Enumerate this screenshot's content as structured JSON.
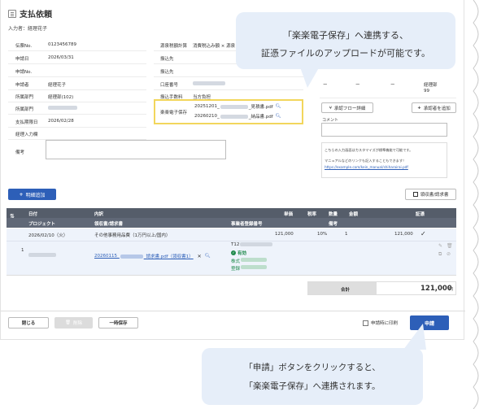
{
  "header": {
    "title": "支払依頼",
    "inputter": "入力者：経理花子"
  },
  "form_left": [
    {
      "label": "伝票No.",
      "value": "0123456789"
    },
    {
      "label": "申請日",
      "value": "2026/03/31"
    },
    {
      "label": "申請No.",
      "value": ""
    },
    {
      "label": "申請者",
      "value": "経理花子"
    },
    {
      "label": "所属部門",
      "value": "経理部(102)"
    },
    {
      "label": "所属部門",
      "value": ""
    },
    {
      "label": "支払期限日",
      "value": "2026/02/28"
    },
    {
      "label": "経理入力欄",
      "value": ""
    },
    {
      "label": "備考",
      "value": ""
    }
  ],
  "form_mid": [
    {
      "label": "源泉税額計算",
      "value": "消費税込み額 × 源泉"
    },
    {
      "label": "振込先",
      "value": ""
    },
    {
      "label": "振込先",
      "value": ""
    },
    {
      "label": "口座番号",
      "value": ""
    },
    {
      "label": "振込手数料",
      "value": "当方負担"
    }
  ],
  "rakuraku": {
    "label": "楽楽電子保存",
    "file1_prefix": "20251201_",
    "file1_suffix": "_見積書.pdf",
    "file2_prefix": "20260210_",
    "file2_suffix": "_納品書.pdf"
  },
  "approval": {
    "cols": [
      "ー",
      "ー",
      "ー",
      "経理部"
    ],
    "sub": "99",
    "flow_button": "承認フロー詳細",
    "add_approver_button": "承認者を追加",
    "comment_label": "コメント"
  },
  "notice": {
    "line1": "こちらの入力画面はカスタマイズが標準機能で可能です。",
    "line2": "マニュアルなどのリンクも記入することもできます！",
    "link": "https://example.com/kein_manual/shiharairai.pdf"
  },
  "toolbar": {
    "add_detail": "明細追加",
    "receipt_button": "領収書/請求書"
  },
  "table": {
    "head1": [
      "日付",
      "内訳",
      "単価",
      "税率",
      "数量",
      "金額",
      "証憑"
    ],
    "head2": [
      "プロジェクト",
      "領収書/請求書",
      "事業者登録番号",
      "備考"
    ],
    "row": {
      "no": "1",
      "date": "2026/02/10（火）",
      "item": "その他事務用品費（1万円以上/国内）",
      "unit_price": "121,000",
      "tax_rate": "10%",
      "quantity": "1",
      "amount": "121,000",
      "file_prefix": "20260115_",
      "file_suffix": "_請求書.pdf（領収書1）",
      "reg_prefix": "T12",
      "reg_status": "有効",
      "reg_line3": "株式",
      "reg_line4": "登録"
    }
  },
  "total": {
    "label": "合計",
    "value": "121,000",
    "unit": "円"
  },
  "footer": {
    "close": "閉じる",
    "delete": "削除",
    "save_temp": "一時保存",
    "print_label": "申請時に印刷",
    "apply": "申請"
  },
  "callouts": {
    "top_line1": "「楽楽電子保存」へ連携する、",
    "top_line2": "証憑ファイルのアップロードが可能です。",
    "bottom_line1": "「申請」ボタンをクリックすると、",
    "bottom_line2": "「楽楽電子保存」へ連携されます。"
  },
  "colors": {
    "primary": "#2d5fb8",
    "highlight": "#f2d65c",
    "bubble": "#e6eef9",
    "header": "#555d6a",
    "row": "#eef3fb"
  }
}
